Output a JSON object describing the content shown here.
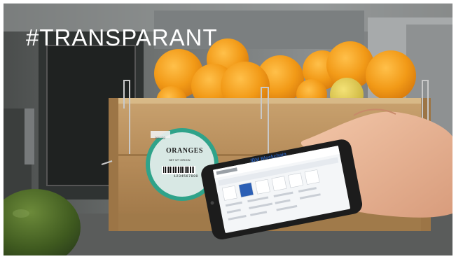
{
  "headline": "#TRANSPARANT",
  "crate_label": {
    "title": "ORANGES",
    "subtitle": "NET WT      ORIGIN",
    "barcode_number": "1234567890",
    "sticker_number": "00123"
  },
  "phone": {
    "app_title": "IBM Blockchain"
  },
  "colors": {
    "label_green": "#2fa38a",
    "orange": "#f2a01e",
    "crate_wood": "#b98e5f",
    "app_blue": "#2b5fb5"
  }
}
